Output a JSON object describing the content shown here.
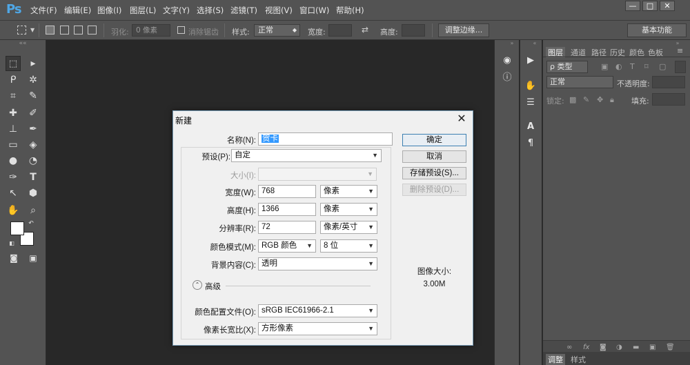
{
  "app": {
    "logo": "Ps"
  },
  "menu": [
    "文件(F)",
    "编辑(E)",
    "图像(I)",
    "图层(L)",
    "文字(Y)",
    "选择(S)",
    "滤镜(T)",
    "视图(V)",
    "窗口(W)",
    "帮助(H)"
  ],
  "window_controls": {
    "minimize": "—",
    "restore": "□",
    "close": "✕"
  },
  "options_bar": {
    "feather_label": "羽化:",
    "feather_value": "0 像素",
    "antialias_label": "消除锯齿",
    "style_label": "样式:",
    "style_value": "正常",
    "width_label": "宽度:",
    "height_label": "高度:",
    "refine_edge": "调整边缘...",
    "workspace": "基本功能"
  },
  "layers_panel": {
    "tabs": [
      "图层",
      "通道",
      "路径",
      "历史",
      "颜色",
      "色板"
    ],
    "filter_value": "ρ 类型",
    "blend_mode": "正常",
    "opacity_label": "不透明度:",
    "lock_label": "锁定:",
    "fill_label": "填充:",
    "bottom_tabs": [
      "调整",
      "样式"
    ]
  },
  "dialog": {
    "title": "新建",
    "name_label": "名称(N):",
    "name_value": "贺卡",
    "preset_label": "预设(P):",
    "preset_value": "自定",
    "size_label": "大小(I):",
    "width_label": "宽度(W):",
    "width_value": "768",
    "width_unit": "像素",
    "height_label": "高度(H):",
    "height_value": "1366",
    "height_unit": "像素",
    "resolution_label": "分辨率(R):",
    "resolution_value": "72",
    "resolution_unit": "像素/英寸",
    "color_mode_label": "颜色模式(M):",
    "color_mode_value": "RGB 颜色",
    "bit_depth_value": "8 位",
    "background_label": "背景内容(C):",
    "background_value": "透明",
    "advanced_label": "高级",
    "color_profile_label": "颜色配置文件(O):",
    "color_profile_value": "sRGB IEC61966-2.1",
    "pixel_aspect_label": "像素长宽比(X):",
    "pixel_aspect_value": "方形像素",
    "ok_button": "确定",
    "cancel_button": "取消",
    "save_preset_button": "存储预设(S)...",
    "delete_preset_button": "删除预设(D)...",
    "image_size_label": "图像大小:",
    "image_size_value": "3.00M"
  }
}
